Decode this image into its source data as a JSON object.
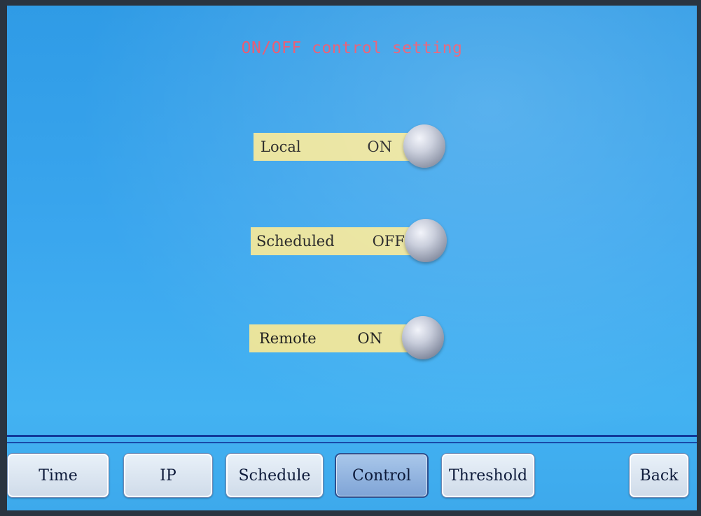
{
  "screen": {
    "title": "ON/OFF control setting",
    "accent_title_color": "#e8506a",
    "background_color": "#3aa6ee",
    "label_bg_color": "#e9e39a"
  },
  "toggles": [
    {
      "label": "Local",
      "state": "ON"
    },
    {
      "label": "Scheduled",
      "state": "OFF"
    },
    {
      "label": "Remote",
      "state": "ON"
    }
  ],
  "tabs": [
    {
      "label": "Time"
    },
    {
      "label": "IP"
    },
    {
      "label": "Schedule"
    },
    {
      "label": "Control",
      "active": true
    },
    {
      "label": "Threshold"
    },
    {
      "label": "Back"
    }
  ],
  "icons": {
    "toggle_knob": "round-knob-icon"
  }
}
